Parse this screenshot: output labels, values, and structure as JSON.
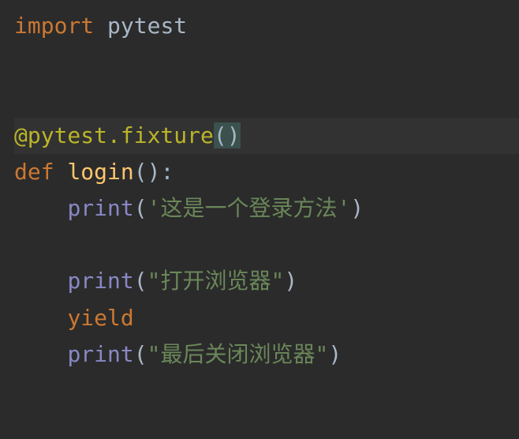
{
  "code": {
    "line1": {
      "kw_import": "import",
      "module": "pytest"
    },
    "line4": {
      "decorator": "@pytest.fixture",
      "paren_open": "(",
      "paren_close": ")"
    },
    "line5": {
      "kw_def": "def",
      "func_name": "login",
      "parens": "()",
      "colon": ":"
    },
    "line6": {
      "builtin": "print",
      "paren_open": "(",
      "string": "'这是一个登录方法'",
      "paren_close": ")"
    },
    "line8": {
      "builtin": "print",
      "paren_open": "(",
      "string": "\"打开浏览器\"",
      "paren_close": ")"
    },
    "line9": {
      "kw_yield": "yield"
    },
    "line10": {
      "builtin": "print",
      "paren_open": "(",
      "string": "\"最后关闭浏览器\"",
      "paren_close": ")"
    }
  }
}
